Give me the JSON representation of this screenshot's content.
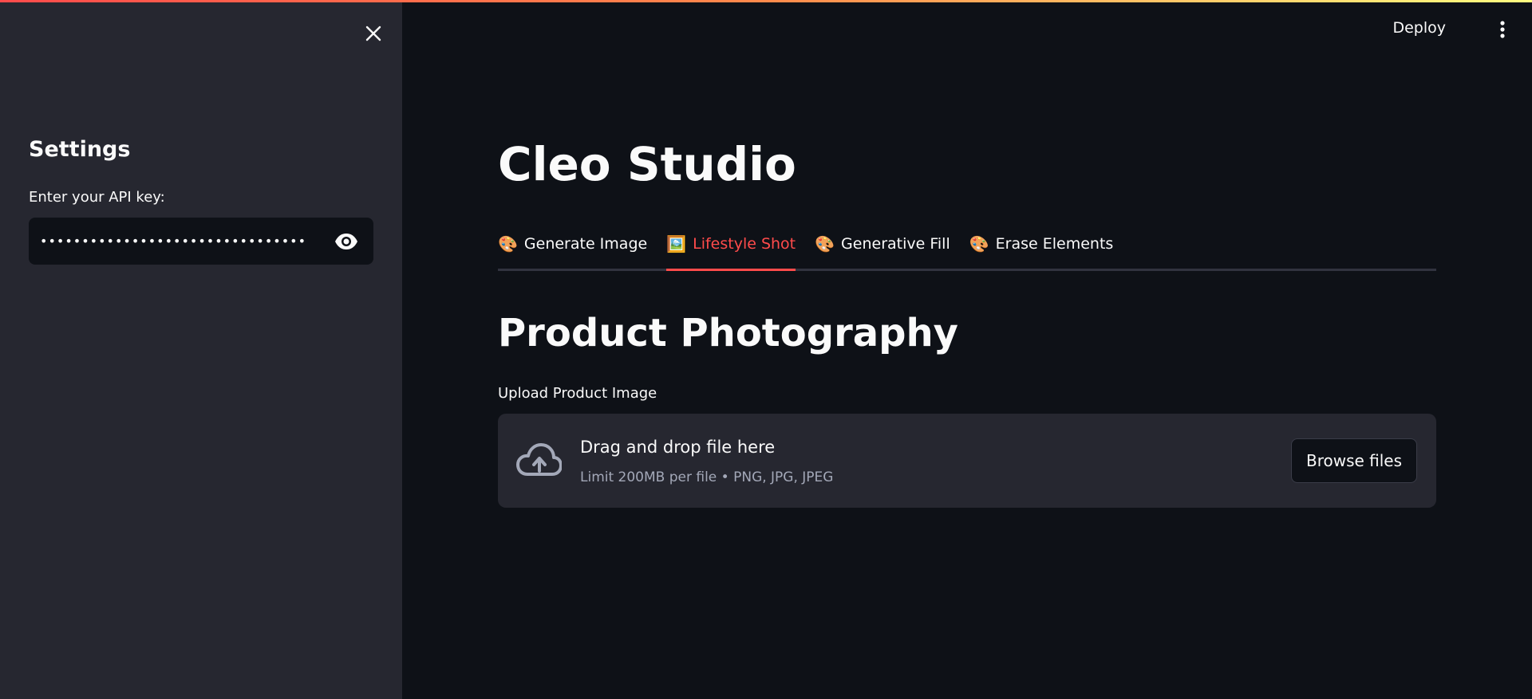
{
  "header": {
    "deploy_label": "Deploy"
  },
  "sidebar": {
    "title": "Settings",
    "api_key_label": "Enter your API key:",
    "api_key_value": "••••••••••••••••••••••••••••••••"
  },
  "main": {
    "title": "Cleo Studio",
    "tabs": [
      {
        "emoji": "🎨",
        "label": "Generate Image",
        "active": false
      },
      {
        "emoji": "🖼️",
        "label": "Lifestyle Shot",
        "active": true
      },
      {
        "emoji": "🎨",
        "label": "Generative Fill",
        "active": false
      },
      {
        "emoji": "🎨",
        "label": "Erase Elements",
        "active": false
      }
    ],
    "section_title": "Product Photography",
    "upload_label": "Upload Product Image",
    "dropzone": {
      "main_text": "Drag and drop file here",
      "sub_text": "Limit 200MB per file • PNG, JPG, JPEG",
      "browse_label": "Browse files"
    }
  },
  "colors": {
    "accent": "#ff4b4b",
    "background": "#0e1117",
    "sidebar": "#262730"
  }
}
